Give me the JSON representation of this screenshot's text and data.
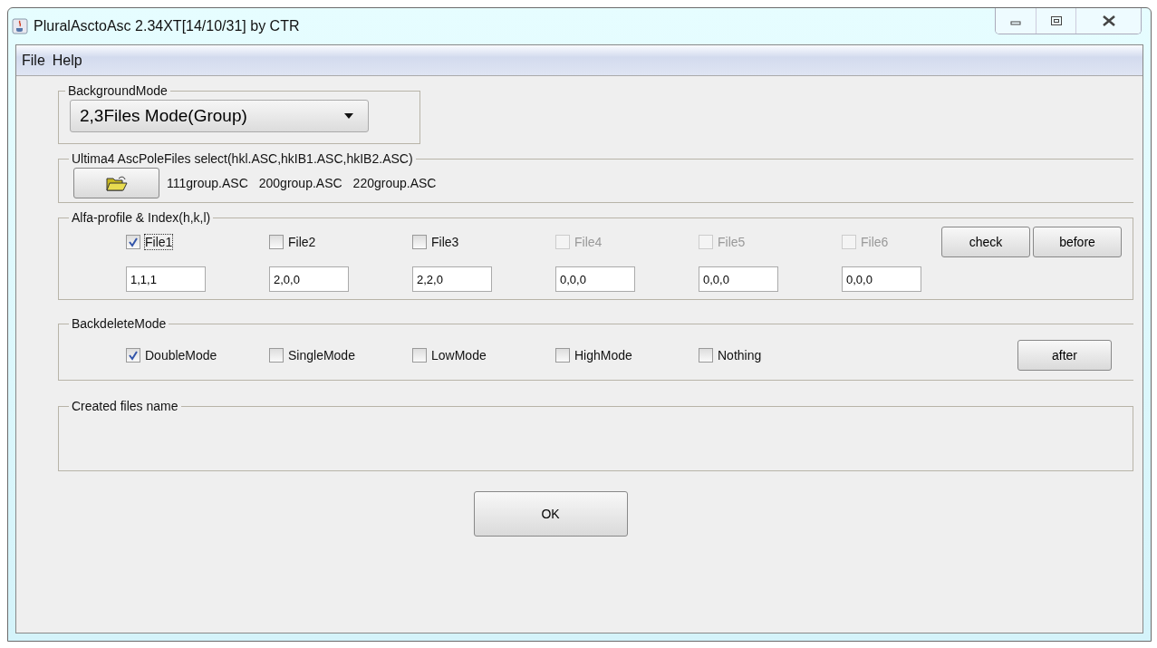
{
  "window": {
    "title": "PluralAsctoAsc 2.34XT[14/10/31] by CTR"
  },
  "menu": [
    "File",
    "Help"
  ],
  "background_mode": {
    "legend": "BackgroundMode",
    "value": "2,3Files Mode(Group)"
  },
  "files_select": {
    "legend": "Ultima4 AscPoleFiles select(hkl.ASC,hkIB1.ASC,hkIB2.ASC)",
    "files": [
      "111group.ASC",
      "200group.ASC",
      "220group.ASC"
    ]
  },
  "profile": {
    "legend": "Alfa-profile & Index(h,k,l)",
    "items": [
      {
        "label": "File1",
        "checked": true,
        "disabled": false,
        "value": "1,1,1"
      },
      {
        "label": "File2",
        "checked": false,
        "disabled": false,
        "value": "2,0,0"
      },
      {
        "label": "File3",
        "checked": false,
        "disabled": false,
        "value": "2,2,0"
      },
      {
        "label": "File4",
        "checked": false,
        "disabled": true,
        "value": "0,0,0"
      },
      {
        "label": "File5",
        "checked": false,
        "disabled": true,
        "value": "0,0,0"
      },
      {
        "label": "File6",
        "checked": false,
        "disabled": true,
        "value": "0,0,0"
      }
    ],
    "buttons": [
      "check",
      "before"
    ]
  },
  "backdelete": {
    "legend": "BackdeleteMode",
    "items": [
      {
        "label": "DoubleMode",
        "checked": true
      },
      {
        "label": "SingleMode",
        "checked": false
      },
      {
        "label": "LowMode",
        "checked": false
      },
      {
        "label": "HighMode",
        "checked": false
      },
      {
        "label": "Nothing",
        "checked": false
      }
    ],
    "button": "after"
  },
  "created": {
    "legend": "Created files name"
  },
  "ok_button": "OK"
}
